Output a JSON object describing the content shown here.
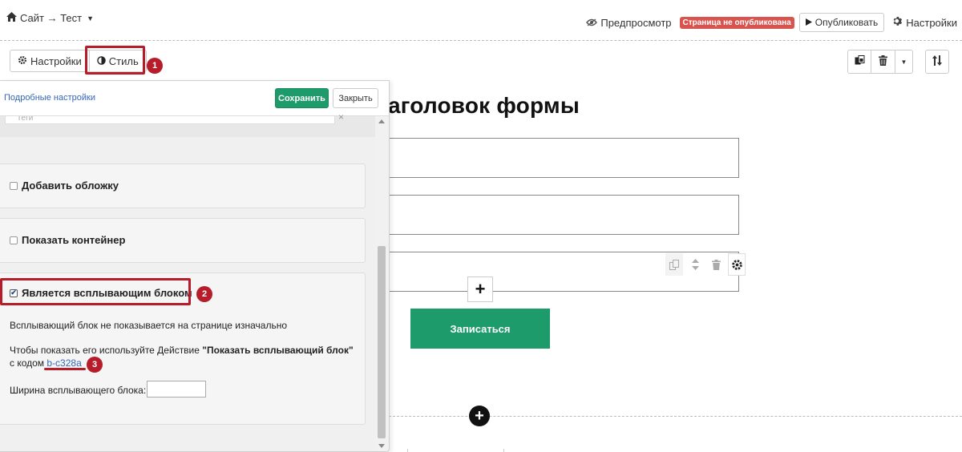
{
  "topbar": {
    "breadcrumb": "Сайт → Тест",
    "preview": "Предпросмотр",
    "unpublished_badge": "Страница не опубликована",
    "publish": "Опубликовать",
    "settings": "Настройки"
  },
  "toolbar": {
    "settings_tab": "Настройки",
    "style_tab": "Стиль"
  },
  "annotations": [
    "1",
    "2",
    "3"
  ],
  "panel": {
    "advanced_link": "Подробные настройки",
    "save": "Сохранить",
    "close": "Закрыть",
    "tags_placeholder": "Теги",
    "add_cover": "Добавить обложку",
    "add_cover_checked": false,
    "show_container": "Показать контейнер",
    "show_container_checked": false,
    "popup_block": "Является всплывающим блоком",
    "popup_block_checked": true,
    "popup_note": "Всплывающий блок не показывается на странице изначально",
    "popup_hint_prefix": "Чтобы показать его используйте Действие ",
    "popup_hint_action": "\"Показать всплывающий блок\"",
    "popup_code_prefix": "с кодом ",
    "popup_code": "b-c328a",
    "popup_width_label": "Ширина всплывающего блока:",
    "popup_width_value": ""
  },
  "canvas": {
    "form_title": "аголовок формы",
    "submit": "Записаться"
  },
  "colors": {
    "accent_green": "#1e9b6a",
    "annotation_red": "#b71c2b",
    "badge_red": "#d9534f",
    "link_blue": "#3366bb"
  },
  "icons": [
    "home-icon",
    "eye-icon",
    "play-icon",
    "gear-icon",
    "contrast-icon",
    "copy-icon",
    "trash-icon",
    "caret-down-icon",
    "sort-icon",
    "plus-icon"
  ]
}
